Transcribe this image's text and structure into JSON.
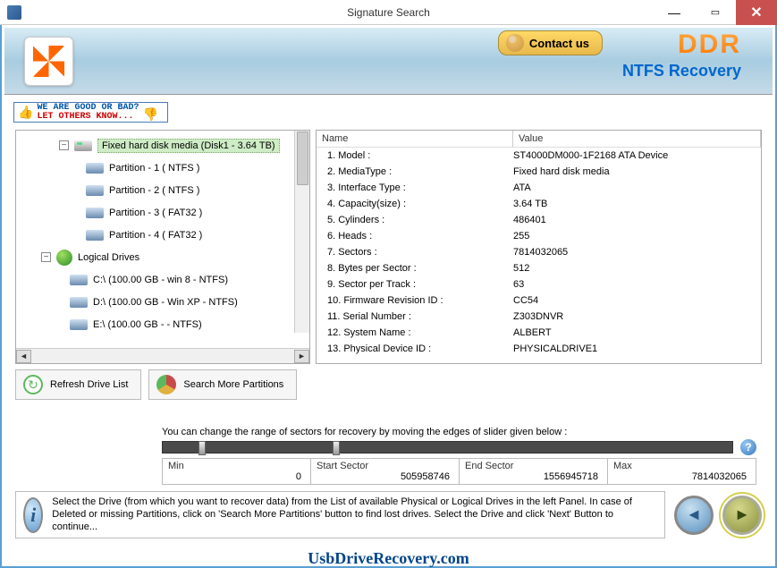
{
  "window": {
    "title": "Signature Search"
  },
  "header": {
    "contact": "Contact us",
    "brand": "DDR",
    "product": "NTFS Recovery"
  },
  "feedback": {
    "line1": "WE ARE GOOD OR BAD?",
    "line2": "LET OTHERS KNOW..."
  },
  "tree": {
    "root": {
      "label": "Fixed hard disk media (Disk1 - 3.64 TB)"
    },
    "partitions": [
      "Partition - 1 ( NTFS )",
      "Partition - 2 ( NTFS )",
      "Partition - 3 ( FAT32 )",
      "Partition - 4 ( FAT32 )"
    ],
    "logical_label": "Logical Drives",
    "logical": [
      "C:\\ (100.00 GB - win 8 - NTFS)",
      "D:\\ (100.00 GB - Win XP - NTFS)",
      "E:\\ (100.00 GB -  - NTFS)"
    ]
  },
  "table": {
    "headers": {
      "name": "Name",
      "value": "Value"
    },
    "rows": [
      {
        "name": "1. Model :",
        "value": "ST4000DM000-1F2168 ATA Device"
      },
      {
        "name": "2. MediaType :",
        "value": "Fixed hard disk media"
      },
      {
        "name": "3. Interface Type :",
        "value": "ATA"
      },
      {
        "name": "4. Capacity(size) :",
        "value": "3.64 TB"
      },
      {
        "name": "5. Cylinders :",
        "value": "486401"
      },
      {
        "name": "6. Heads :",
        "value": "255"
      },
      {
        "name": "7. Sectors :",
        "value": "7814032065"
      },
      {
        "name": "8. Bytes per Sector :",
        "value": "512"
      },
      {
        "name": "9. Sector per Track :",
        "value": "63"
      },
      {
        "name": "10. Firmware Revision ID :",
        "value": "CC54"
      },
      {
        "name": "11. Serial Number :",
        "value": "Z303DNVR"
      },
      {
        "name": "12. System Name :",
        "value": "ALBERT"
      },
      {
        "name": "13. Physical Device ID :",
        "value": "PHYSICALDRIVE1"
      }
    ]
  },
  "actions": {
    "refresh": "Refresh Drive List",
    "search": "Search More Partitions"
  },
  "slider": {
    "caption": "You can change the range of sectors for recovery by moving the edges of slider given below :",
    "fields": {
      "min": {
        "label": "Min",
        "value": "0"
      },
      "start": {
        "label": "Start Sector",
        "value": "505958746"
      },
      "end": {
        "label": "End Sector",
        "value": "1556945718"
      },
      "max": {
        "label": "Max",
        "value": "7814032065"
      }
    }
  },
  "footer": {
    "text": "Select the Drive (from which you want to recover data) from the List of available Physical or Logical Drives in the left Panel. In case of Deleted or missing Partitions, click on 'Search More Partitions' button to find lost drives. Select the Drive and click 'Next' Button to continue..."
  },
  "watermark": "UsbDriveRecovery.com"
}
